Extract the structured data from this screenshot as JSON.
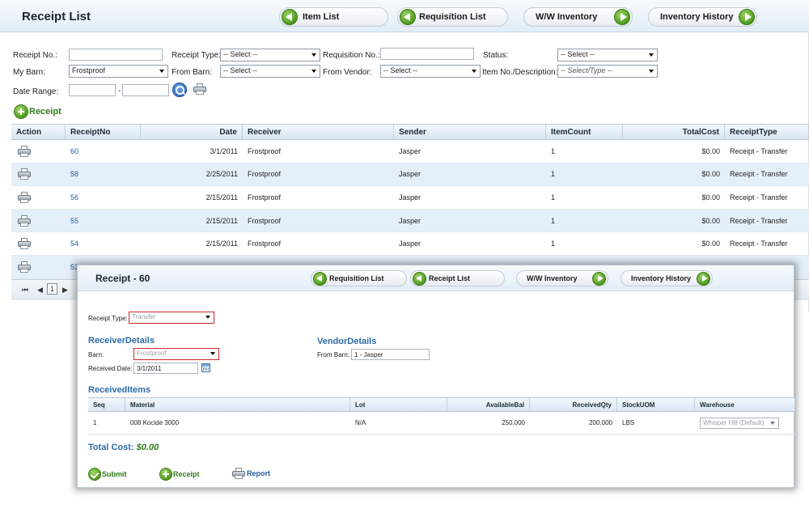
{
  "main": {
    "title": "Receipt List",
    "nav": {
      "item_list": "Item List",
      "requisition_list": "Requisition List",
      "ww_inventory": "W/W Inventory",
      "inventory_history": "Inventory History"
    },
    "filters": {
      "receipt_no_label": "Receipt No.:",
      "receipt_no_value": "",
      "receipt_type_label": "Receipt Type:",
      "receipt_type_value": "-- Select --",
      "requisition_no_label": "Requisition No.:",
      "requisition_no_value": "",
      "status_label": "Status:",
      "status_value": "-- Select --",
      "my_barn_label": "My Barn:",
      "my_barn_value": "Frostproof",
      "from_barn_label": "From Barn:",
      "from_barn_value": "-- Select --",
      "from_vendor_label": "From Vendor:",
      "from_vendor_value": "-- Select --",
      "item_no_label": "Item No./Description:",
      "item_no_value": "-- Select/Type --",
      "date_range_label": "Date Range:",
      "date_from": "",
      "date_separator": "-",
      "date_to": ""
    },
    "add_receipt_label": "Receipt",
    "table": {
      "headers": [
        "Action",
        "ReceiptNo",
        "Date",
        "Receiver",
        "Sender",
        "ItemCount",
        "TotalCost",
        "ReceiptType"
      ],
      "rows": [
        {
          "receipt_no": "60",
          "date": "3/1/2011",
          "receiver": "Frostproof",
          "sender": "Jasper",
          "item_count": "1",
          "total_cost": "$0.00",
          "receipt_type": "Receipt - Transfer"
        },
        {
          "receipt_no": "58",
          "date": "2/25/2011",
          "receiver": "Frostproof",
          "sender": "Jasper",
          "item_count": "1",
          "total_cost": "$0.00",
          "receipt_type": "Receipt - Transfer"
        },
        {
          "receipt_no": "56",
          "date": "2/15/2011",
          "receiver": "Frostproof",
          "sender": "Jasper",
          "item_count": "1",
          "total_cost": "$0.00",
          "receipt_type": "Receipt - Transfer"
        },
        {
          "receipt_no": "55",
          "date": "2/15/2011",
          "receiver": "Frostproof",
          "sender": "Jasper",
          "item_count": "1",
          "total_cost": "$0.00",
          "receipt_type": "Receipt - Transfer"
        },
        {
          "receipt_no": "54",
          "date": "2/15/2011",
          "receiver": "Frostproof",
          "sender": "Jasper",
          "item_count": "1",
          "total_cost": "$0.00",
          "receipt_type": "Receipt - Transfer"
        },
        {
          "receipt_no": "53",
          "date": "",
          "receiver": "",
          "sender": "",
          "item_count": "",
          "total_cost": "",
          "receipt_type": ""
        }
      ]
    },
    "pager": {
      "first": "⏮",
      "prev": "◀",
      "page": "1",
      "next": "▶"
    }
  },
  "detail": {
    "title": "Receipt - 60",
    "nav": {
      "requisition_list": "Requisition List",
      "receipt_list": "Receipt List",
      "ww_inventory": "W/W Inventory",
      "inventory_history": "Inventory History"
    },
    "receipt_type_label": "Receipt Type:",
    "receipt_type_value": "Transfer",
    "receiver_section": "ReceiverDetails",
    "barn_label": "Barn:",
    "barn_value": "Frostproof",
    "received_date_label": "Received Date:",
    "received_date_value": "3/1/2011",
    "vendor_section": "VendorDetails",
    "from_barn_label": "From Barn:",
    "from_barn_value": "1 - Jasper",
    "items_section": "ReceivedItems",
    "items": {
      "headers": [
        "Seq",
        "Material",
        "Lot",
        "AvailableBal",
        "ReceivedQty",
        "StockUOM",
        "Warehouse"
      ],
      "rows": [
        {
          "seq": "1",
          "material": "008 Kocide 3000",
          "lot": "N/A",
          "available_bal": "250.000",
          "received_qty": "200.000",
          "stock_uom": "LBS",
          "warehouse": "Whisper Hill (Default)"
        }
      ]
    },
    "total_cost_label": "Total Cost:",
    "total_cost_value": "$0.00",
    "actions": {
      "submit": "Submit",
      "receipt": "Receipt",
      "report": "Report"
    }
  },
  "colors": {
    "accent_blue": "#2d6aa8",
    "link_blue": "#1e5e9e",
    "action_green": "#2f7a1a",
    "row_alt": "#e5effa",
    "readonly_border": "#c9282a"
  },
  "icons": {
    "nav_back": "arrow-left-icon",
    "nav_forward": "arrow-right-icon",
    "search": "search-icon",
    "print": "printer-icon",
    "add": "plus-icon",
    "submit": "check-icon",
    "calendar": "calendar-icon"
  }
}
